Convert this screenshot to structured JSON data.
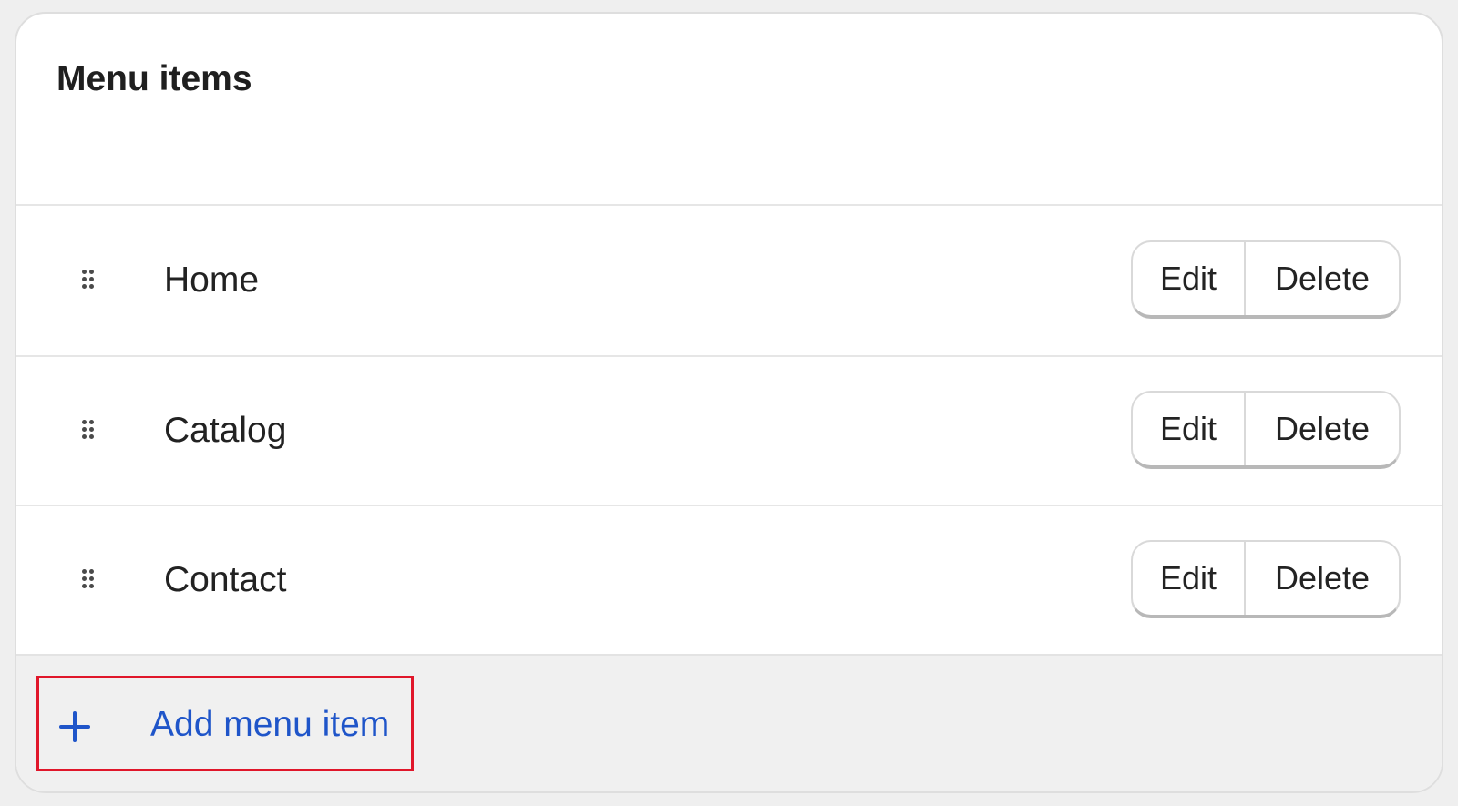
{
  "card": {
    "title": "Menu items"
  },
  "menu_items": [
    {
      "label": "Home",
      "edit_label": "Edit",
      "delete_label": "Delete"
    },
    {
      "label": "Catalog",
      "edit_label": "Edit",
      "delete_label": "Delete"
    },
    {
      "label": "Contact",
      "edit_label": "Edit",
      "delete_label": "Delete"
    }
  ],
  "footer": {
    "add_label": "Add menu item",
    "add_icon": "plus-icon",
    "highlight_color": "#e0162a"
  },
  "icons": {
    "drag_handle": "drag-handle-icon"
  },
  "colors": {
    "link": "#1f55c9",
    "text": "#222222",
    "footer_background": "#f0f0f0"
  }
}
